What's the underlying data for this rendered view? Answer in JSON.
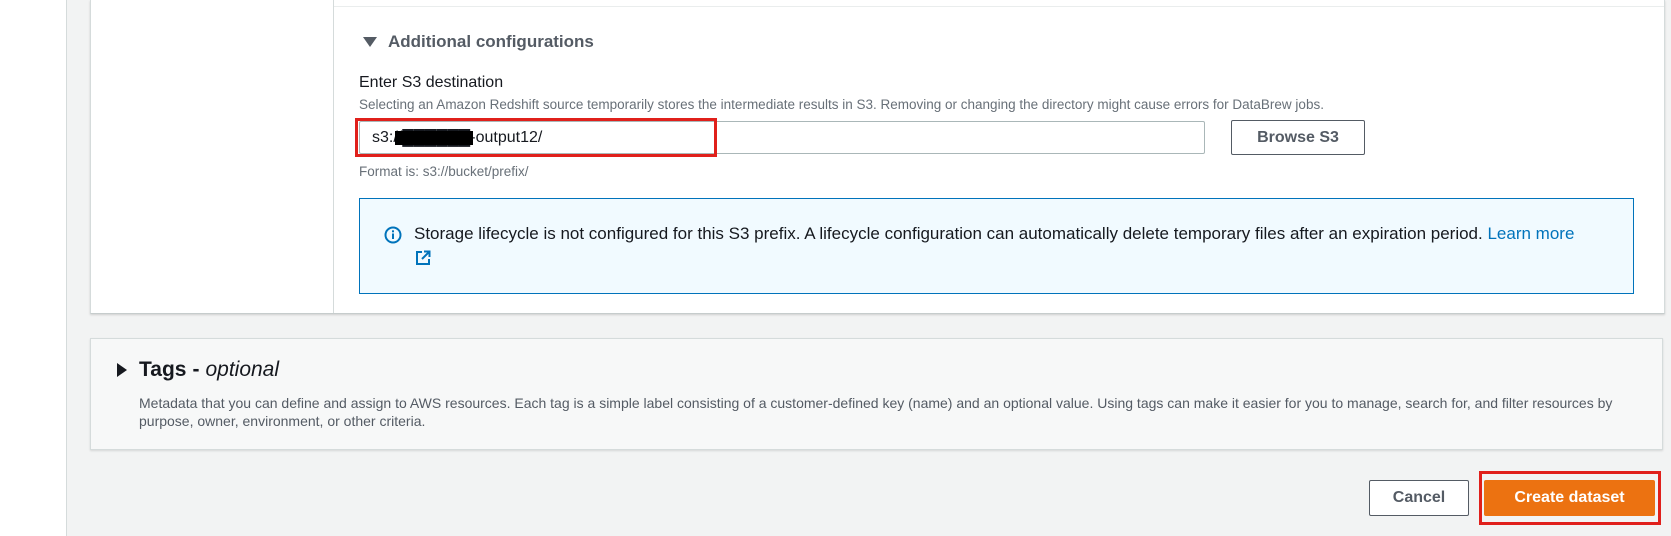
{
  "additional_config": {
    "toggle_label": "Additional configurations",
    "s3_label": "Enter S3 destination",
    "s3_description": "Selecting an Amazon Redshift source temporarily stores the intermediate results in S3. Removing or changing the directory might cause errors for DataBrew jobs.",
    "s3_value": "s3://██████-output12/",
    "browse_label": "Browse S3",
    "format_hint": "Format is: s3://bucket/prefix/",
    "alert_text": "Storage lifecycle is not configured for this S3 prefix. A lifecycle configuration can automatically delete temporary files after an expiration period.",
    "alert_link": "Learn more"
  },
  "tags": {
    "title": "Tags",
    "separator": "-",
    "optional": "optional",
    "description": "Metadata that you can define and assign to AWS resources. Each tag is a simple label consisting of a customer-defined key (name) and an optional value. Using tags can make it easier for you to manage, search for, and filter resources by purpose, owner, environment, or other criteria."
  },
  "footer": {
    "cancel_label": "Cancel",
    "create_label": "Create dataset"
  },
  "colors": {
    "primary_button": "#ec7211",
    "highlight": "#e0201b",
    "info_border": "#0073bb",
    "link": "#0073bb"
  },
  "icons": {
    "toggle_open": "caret-down-icon",
    "toggle_closed": "caret-right-icon",
    "info": "info-icon",
    "external_link": "external-link-icon"
  }
}
